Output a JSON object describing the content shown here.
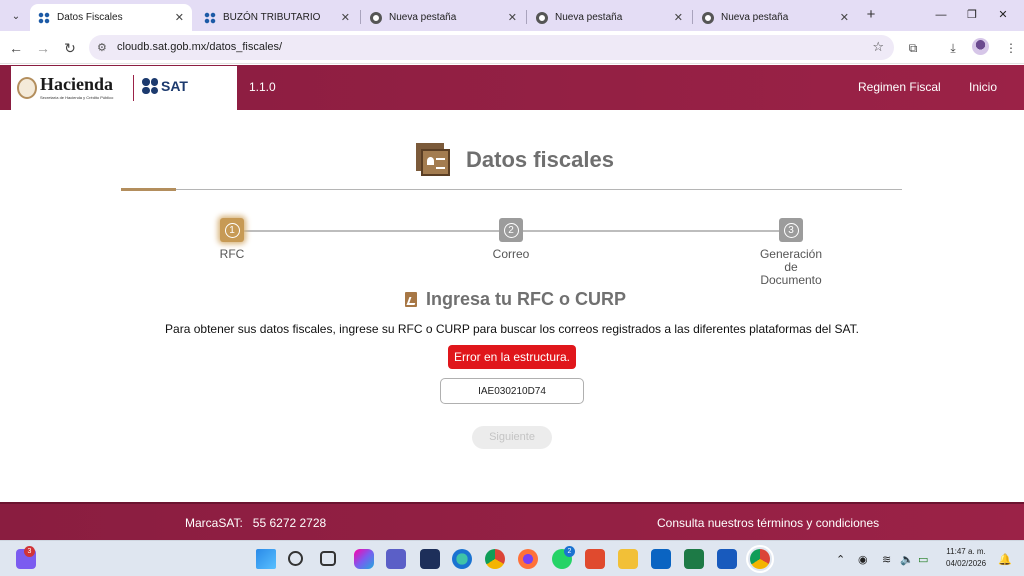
{
  "browser": {
    "tabs": [
      {
        "title": "Datos Fiscales",
        "active": true,
        "icon": "sat-favicon"
      },
      {
        "title": "BUZÓN TRIBUTARIO",
        "active": false,
        "icon": "sat-favicon"
      },
      {
        "title": "Nueva pestaña",
        "active": false,
        "icon": "chrome-icon"
      },
      {
        "title": "Nueva pestaña",
        "active": false,
        "icon": "chrome-icon"
      },
      {
        "title": "Nueva pestaña",
        "active": false,
        "icon": "chrome-icon"
      }
    ],
    "url": "cloudb.sat.gob.mx/datos_fiscales/"
  },
  "header": {
    "brand": "Hacienda",
    "brand_sub": "Secretaría de Hacienda y Crédito Público",
    "sat_label": "SAT",
    "version": "1.1.0",
    "nav": [
      "Regimen Fiscal",
      "Inicio"
    ]
  },
  "main": {
    "title": "Datos fiscales",
    "steps": [
      {
        "num": "1",
        "label": "RFC",
        "active": true
      },
      {
        "num": "2",
        "label": "Correo",
        "active": false
      },
      {
        "num": "3",
        "label": "Generación de Documento",
        "label_lines": [
          "Generación",
          "de",
          "Documento"
        ],
        "active": false
      }
    ],
    "subtitle": "Ingresa tu RFC o CURP",
    "instructions": "Para obtener sus datos fiscales, ingrese su RFC o CURP para buscar los correos registrados a las diferentes plataformas del SAT.",
    "error": "Error en la estructura.",
    "rfc_value": "IAE030210D74",
    "next_label": "Siguiente"
  },
  "footer": {
    "brand_phone": "MarcaSAT:   55 6272 2728",
    "terms": "Consulta nuestros términos y condiciones"
  },
  "taskbar": {
    "clock_time": "11:47 a. m.",
    "clock_date": "04/02/2026",
    "badges": {
      "teams": "3",
      "whatsapp": "2"
    }
  },
  "colors": {
    "brand": "#9b2247",
    "accent": "#b38e5d",
    "error": "#e0161b"
  }
}
